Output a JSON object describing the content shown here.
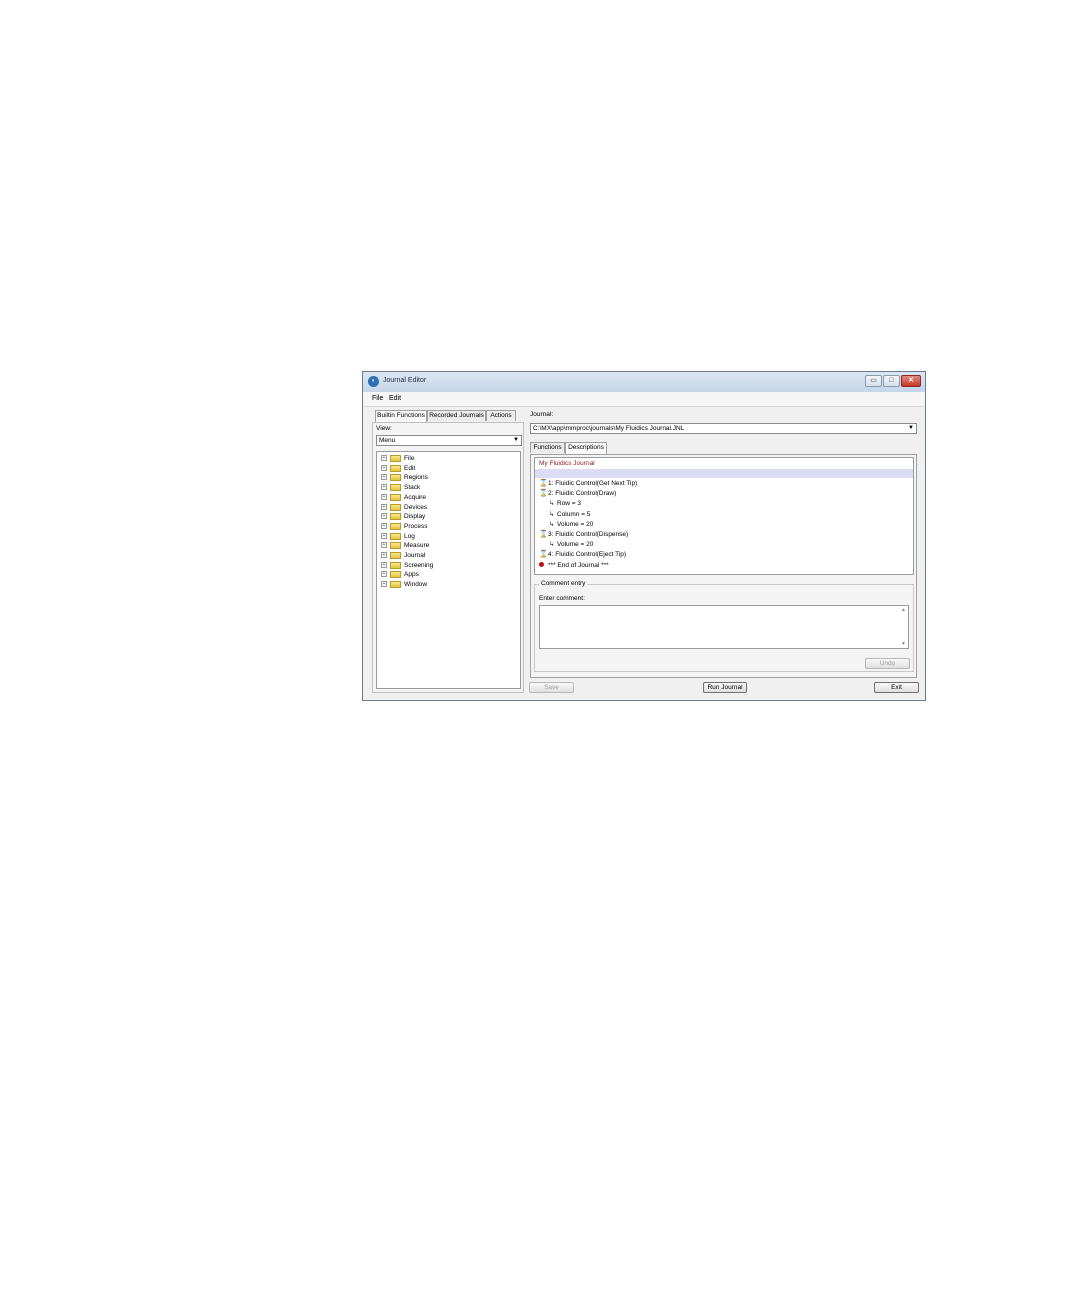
{
  "window": {
    "title": "Journal Editor",
    "app_icon_glyph": "◐",
    "controls": {
      "minimize": "▭",
      "maximize": "□",
      "close": "✕"
    }
  },
  "menu": {
    "items": [
      "File",
      "Edit"
    ]
  },
  "left_panel": {
    "tabs": [
      "Builtin Functions",
      "Recorded Journals",
      "Actions"
    ],
    "view_label": "View:",
    "view_value": "Menu",
    "tree": [
      "File",
      "Edit",
      "Regions",
      "Stack",
      "Acquire",
      "Devices",
      "Display",
      "Process",
      "Log",
      "Measure",
      "Journal",
      "Screening",
      "Apps",
      "Window"
    ]
  },
  "journal": {
    "label": "Journal:",
    "path": "C:\\MX\\app\\mmproc\\journals\\My Fluidics Journal.JNL"
  },
  "right_tabs": [
    "Functions",
    "Descriptions"
  ],
  "descriptions": {
    "title": "My Fluidics Journal",
    "steps": [
      {
        "kind": "step",
        "text": "1: Fluidic Control(Get Next Tip)"
      },
      {
        "kind": "step",
        "text": "2: Fluidic Control(Draw)"
      },
      {
        "kind": "param",
        "text": "Row = 3"
      },
      {
        "kind": "param",
        "text": "Column = 5"
      },
      {
        "kind": "param",
        "text": "Volume = 20"
      },
      {
        "kind": "step",
        "text": "3: Fluidic Control(Dispense)"
      },
      {
        "kind": "param",
        "text": "Volume = 20"
      },
      {
        "kind": "step",
        "text": "4: Fluidic Control(Eject Tip)"
      },
      {
        "kind": "end",
        "text": "*** End of Journal ***"
      }
    ]
  },
  "comment": {
    "group_label": "Comment entry",
    "enter_label": "Enter comment:",
    "value": "",
    "undo_label": "Undo"
  },
  "buttons": {
    "save": "Save",
    "run": "Run Journal",
    "exit": "Exit"
  },
  "colors": {
    "title_text": "#8c1a1a",
    "selection": "#dcdcf5",
    "hourglass": "#1f8fb8",
    "end_marker": "#c01010"
  }
}
